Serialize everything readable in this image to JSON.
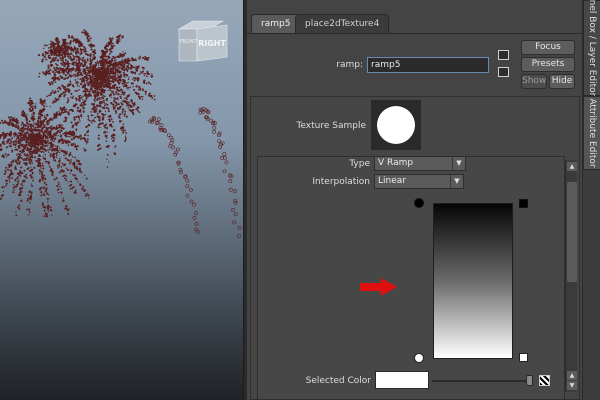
{
  "viewport": {
    "view_cube": {
      "right_label": "RIGHT",
      "front_label": "FRONT"
    },
    "particle_color": "#5a2020",
    "arrow_color": "#e01010"
  },
  "tabs": [
    {
      "label": "ramp5",
      "active": true
    },
    {
      "label": "place2dTexture4",
      "active": false
    }
  ],
  "node": {
    "label": "ramp:",
    "value": "ramp5"
  },
  "buttons": {
    "focus": "Focus",
    "presets": "Presets",
    "show": "Show",
    "hide": "Hide"
  },
  "texture_sample": {
    "label": "Texture Sample"
  },
  "ramp_attrs": {
    "type_label": "Type",
    "type_value": "V Ramp",
    "interp_label": "Interpolation",
    "interp_value": "Linear"
  },
  "ramp_gradient": {
    "top_color": "#050505",
    "bottom_color": "#ffffff"
  },
  "selected_color": {
    "label": "Selected Color",
    "value": "#ffffff"
  },
  "side_tabs": [
    {
      "label": "nel Box / Layer Editor",
      "active": false
    },
    {
      "label": "Attribute Editor",
      "active": true
    }
  ]
}
